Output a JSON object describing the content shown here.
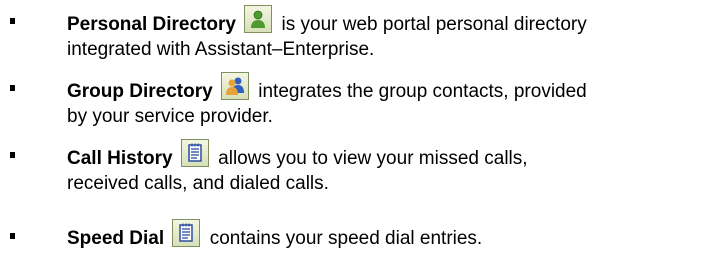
{
  "items": [
    {
      "title": "Personal Directory",
      "icon": "personal-directory-icon",
      "line1_rest": "is your web portal personal directory",
      "line2": "integrated with Assistant–Enterprise."
    },
    {
      "title": "Group Directory",
      "icon": "group-directory-icon",
      "line1_rest": "integrates the group contacts, provided",
      "line2": "by your service provider."
    },
    {
      "title": "Call History",
      "icon": "call-history-icon",
      "line1_rest": "allows you to view your missed calls,",
      "line2": "received calls, and dialed calls."
    },
    {
      "title": "Speed Dial",
      "icon": "speed-dial-icon",
      "line1_rest": "contains your speed dial entries."
    }
  ],
  "colors": {
    "icon_border": "#7f8f5f",
    "icon_background": "#e4ebc9",
    "person_green": "#4f9a2e",
    "person_blue": "#2f5fbf",
    "notepad_blue": "#2b4f9e"
  }
}
